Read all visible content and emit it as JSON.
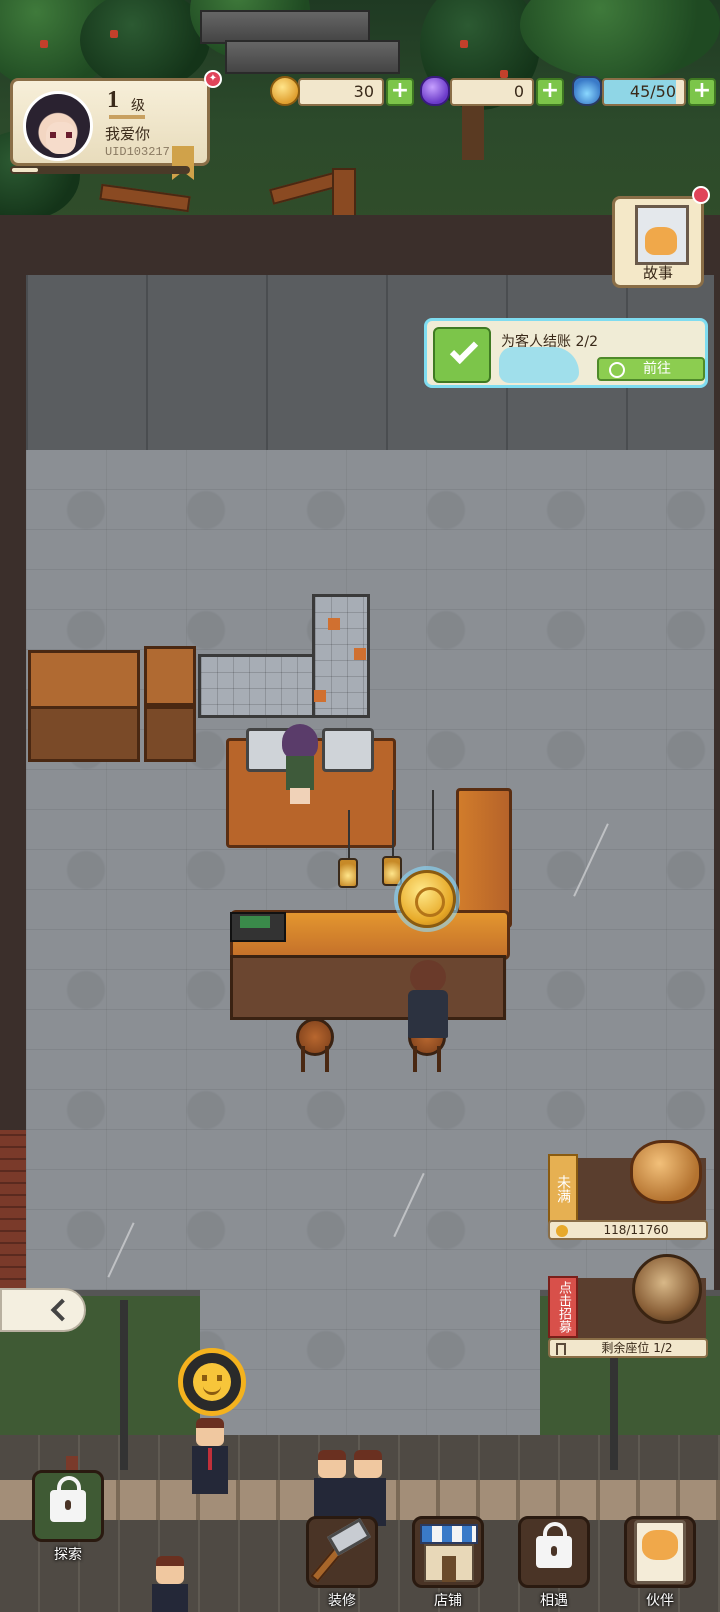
{
  "player": {
    "level": "1",
    "level_unit": "级",
    "name": "我爱你",
    "uid": "UID103217",
    "level_progress": 0.15,
    "has_notification": true
  },
  "resources": {
    "coins": "30",
    "gems": "0",
    "energy": "45/50",
    "energy_fraction": 0.9
  },
  "story": {
    "label": "故事",
    "has_notification": true
  },
  "quest": {
    "text": "为客人结账 2/2",
    "go_label": "前往",
    "completed": true
  },
  "piggy_bank": {
    "status_label": "未满",
    "count": "118/11760"
  },
  "recruit": {
    "label": "点击招募",
    "seats": "剩余座位 1/2"
  },
  "bottom_nav": {
    "explore": {
      "label": "探索",
      "locked": true
    },
    "decorate": {
      "label": "装修",
      "locked": false
    },
    "shop": {
      "label": "店铺",
      "locked": false
    },
    "encounter": {
      "label": "相遇",
      "locked": true
    },
    "partner": {
      "label": "伙伴",
      "locked": false
    }
  },
  "colors": {
    "accent_green": "#7cc54a",
    "notif_red": "#e0445a",
    "panel_cream": "#f2e7cc",
    "highlight_cyan": "#7fdcf0"
  },
  "icons": {
    "coin": "coin-icon",
    "gem": "gem-icon",
    "energy": "potion-icon",
    "collapse": "chevron-left-icon",
    "mood": "smile-icon"
  }
}
